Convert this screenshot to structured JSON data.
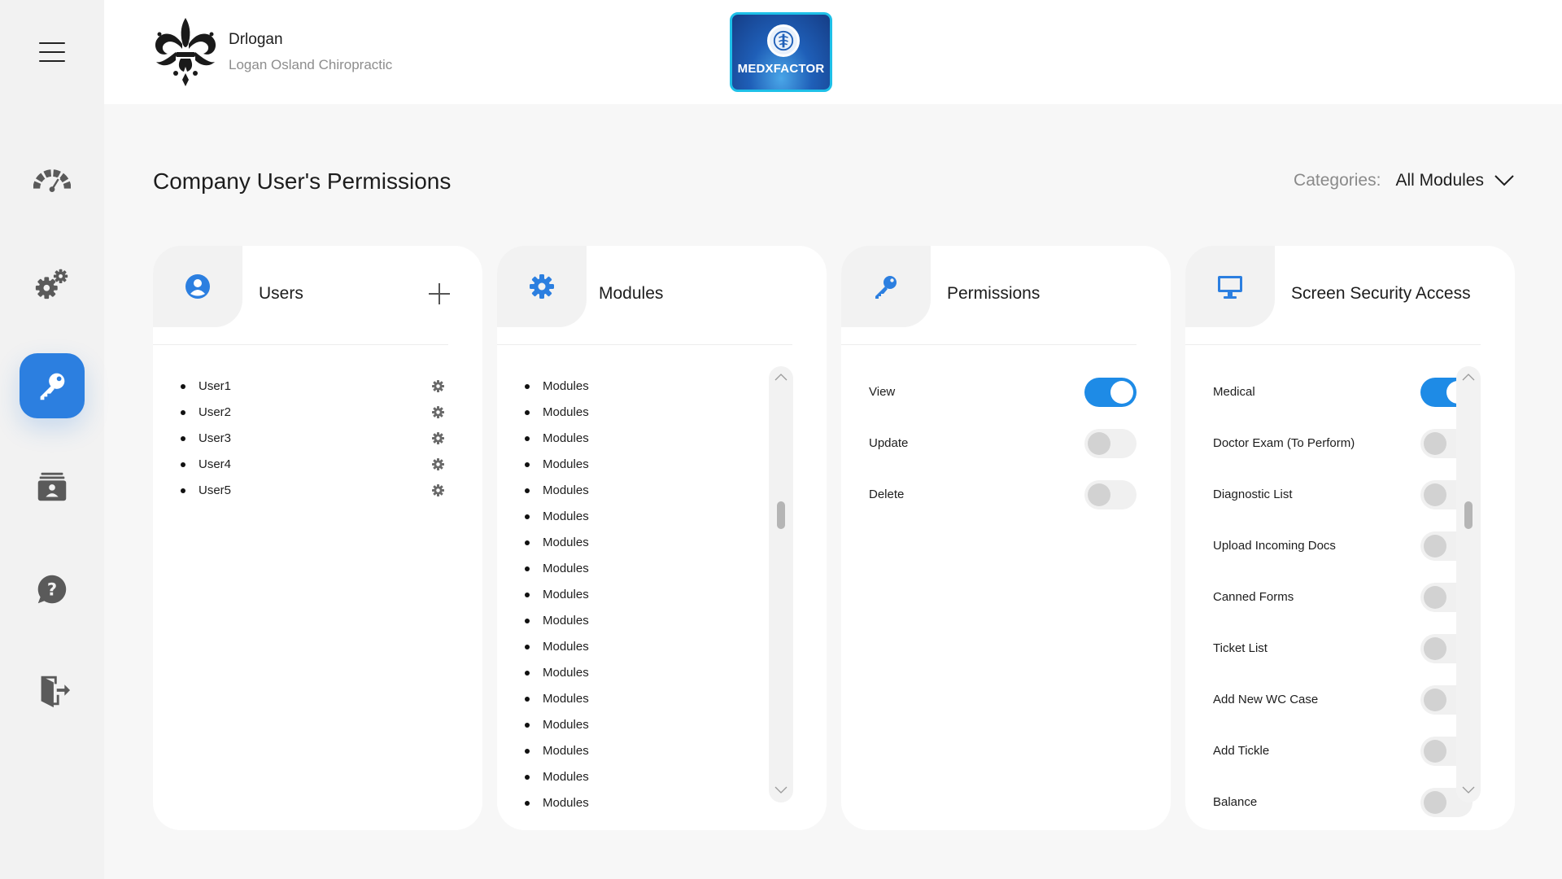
{
  "brand": {
    "name": "Drlogan",
    "subtitle": "Logan Osland Chiropractic"
  },
  "app_logo": {
    "text": "MEDXFACTOR"
  },
  "page": {
    "title": "Company User's Permissions"
  },
  "categories": {
    "label": "Categories:",
    "selected": "All Modules"
  },
  "sidebar": {
    "items": [
      {
        "icon": "dashboard-gauge-icon",
        "active": false
      },
      {
        "icon": "settings-gears-icon",
        "active": false
      },
      {
        "icon": "key-icon",
        "active": true
      },
      {
        "icon": "contacts-card-icon",
        "active": false
      },
      {
        "icon": "help-chat-icon",
        "active": false
      },
      {
        "icon": "logout-door-icon",
        "active": false
      }
    ]
  },
  "cards": {
    "users": {
      "title": "Users",
      "icon": "user-circle-icon",
      "items": [
        "User1",
        "User2",
        "User3",
        "User4",
        "User5"
      ]
    },
    "modules": {
      "title": "Modules",
      "icon": "gear-icon",
      "items": [
        "Modules",
        "Modules",
        "Modules",
        "Modules",
        "Modules",
        "Modules",
        "Modules",
        "Modules",
        "Modules",
        "Modules",
        "Modules",
        "Modules",
        "Modules",
        "Modules",
        "Modules",
        "Modules",
        "Modules"
      ]
    },
    "permissions": {
      "title": "Permissions",
      "icon": "key-icon",
      "items": [
        {
          "label": "View",
          "on": true
        },
        {
          "label": "Update",
          "on": false
        },
        {
          "label": "Delete",
          "on": false
        }
      ]
    },
    "screen_security": {
      "title": "Screen Security Access",
      "icon": "monitor-icon",
      "items": [
        {
          "label": "Medical",
          "on": true
        },
        {
          "label": "Doctor Exam (To Perform)",
          "on": false
        },
        {
          "label": "Diagnostic List",
          "on": false
        },
        {
          "label": "Upload Incoming Docs",
          "on": false
        },
        {
          "label": "Canned Forms",
          "on": false
        },
        {
          "label": "Ticket List",
          "on": false
        },
        {
          "label": "Add New WC Case",
          "on": false
        },
        {
          "label": "Add Tickle",
          "on": false
        },
        {
          "label": "Balance",
          "on": false
        }
      ]
    }
  },
  "colors": {
    "accent": "#2c7fe0",
    "toggle_on": "#1e8be6",
    "sidebar_bg": "#f2f2f2",
    "page_bg": "#f7f7f7"
  }
}
